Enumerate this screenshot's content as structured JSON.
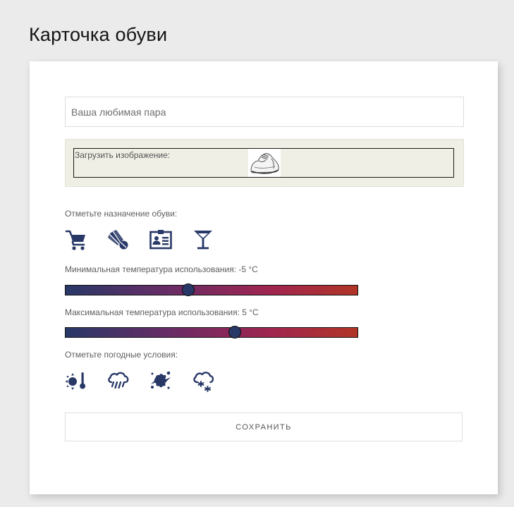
{
  "page": {
    "title": "Карточка обуви"
  },
  "form": {
    "name_placeholder": "Ваша любимая пара",
    "name_value": "",
    "upload_label": "Загрузить изображение:",
    "purpose_label": "Отметьте назначение обуви:",
    "purpose_icons": [
      "cart-icon",
      "shuttlecock-icon",
      "id-card-icon",
      "cocktail-glass-icon"
    ],
    "min_temp_label": "Минимальная температура использования: -5 °C",
    "min_temp_value": -5,
    "max_temp_label": "Максимальная температура использования: 5 °C",
    "max_temp_value": 5,
    "weather_label": "Отметьте погодные условия:",
    "weather_icons": [
      "sun-thermometer-icon",
      "rain-cloud-icon",
      "splash-icon",
      "snow-cloud-icon"
    ],
    "save_label": "СОХРАНИТЬ"
  },
  "colors": {
    "icon": "#283867",
    "slider_gradient": [
      "#283867",
      "#682c66",
      "#a02550",
      "#b13526"
    ]
  }
}
